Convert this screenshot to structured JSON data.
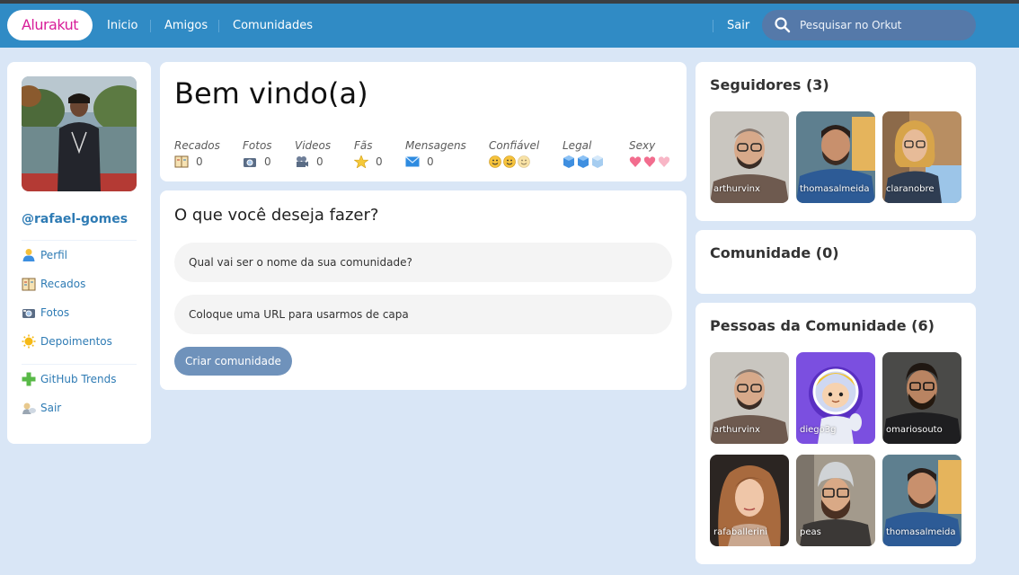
{
  "header": {
    "logo": "Alurakut",
    "nav": [
      "Inicio",
      "Amigos",
      "Comunidades"
    ],
    "logout": "Sair",
    "search_placeholder": "Pesquisar no Orkut"
  },
  "profile": {
    "username": "@rafael-gomes",
    "menu": [
      {
        "label": "Perfil",
        "icon": "user-icon"
      },
      {
        "label": "Recados",
        "icon": "book-icon"
      },
      {
        "label": "Fotos",
        "icon": "camera-icon"
      },
      {
        "label": "Depoimentos",
        "icon": "sun-icon"
      },
      {
        "label": "GitHub Trends",
        "icon": "plus-icon"
      },
      {
        "label": "Sair",
        "icon": "logout-icon"
      }
    ]
  },
  "welcome": {
    "title": "Bem vindo(a)",
    "stats": [
      {
        "label": "Recados",
        "value": "0",
        "icon": "book-icon"
      },
      {
        "label": "Fotos",
        "value": "0",
        "icon": "camera-icon"
      },
      {
        "label": "Videos",
        "value": "0",
        "icon": "video-camera-icon"
      },
      {
        "label": "Fãs",
        "value": "0",
        "icon": "star-icon"
      },
      {
        "label": "Mensagens",
        "value": "0",
        "icon": "mail-icon"
      },
      {
        "label": "Confiável",
        "icon": "smiley-icon",
        "level": 2,
        "max": 3
      },
      {
        "label": "Legal",
        "icon": "ice-cube-icon",
        "level": 2,
        "max": 3
      },
      {
        "label": "Sexy",
        "icon": "heart-icon",
        "level": 2,
        "max": 3
      }
    ]
  },
  "create": {
    "title": "O que você deseja fazer?",
    "name_placeholder": "Qual vai ser o nome da sua comunidade?",
    "url_placeholder": "Coloque uma URL para usarmos de capa",
    "button": "Criar comunidade"
  },
  "followers": {
    "title": "Seguidores (3)",
    "items": [
      "arthurvinx",
      "thomasalmeida",
      "claranobre"
    ]
  },
  "communities": {
    "title": "Comunidade (0)"
  },
  "people": {
    "title": "Pessoas da Comunidade (6)",
    "items": [
      "arthurvinx",
      "diego3g",
      "omariosouto",
      "rafaballerini",
      "peas",
      "thomasalmeida"
    ]
  },
  "colors": {
    "topbar": "#308bc5",
    "background": "#d9e6f6",
    "link": "#2e7bb4",
    "logo": "#d81d99",
    "button": "#6f92bb"
  }
}
